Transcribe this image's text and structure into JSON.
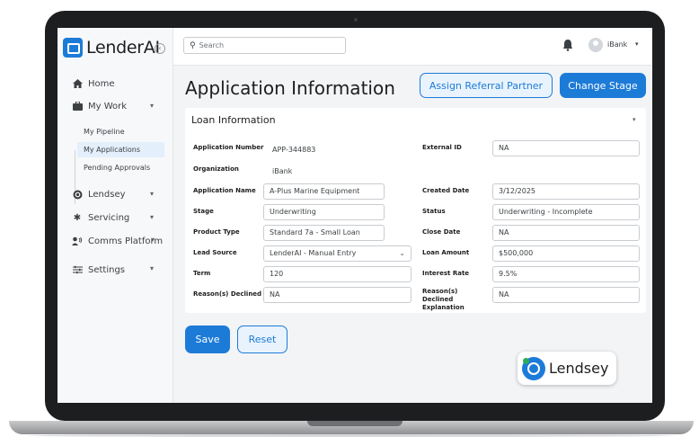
{
  "app": {
    "logo_text": "LenderAI"
  },
  "sidebar": {
    "items": [
      {
        "label": "Home"
      },
      {
        "label": "My Work"
      },
      {
        "label": "Lendsey"
      },
      {
        "label": "Servicing"
      },
      {
        "label": "Comms Platform"
      },
      {
        "label": "Settings"
      }
    ],
    "sub_items": [
      {
        "label": "My Pipeline",
        "active": false
      },
      {
        "label": "My Applications",
        "active": true
      },
      {
        "label": "Pending Approvals",
        "active": false
      }
    ]
  },
  "topbar": {
    "search_placeholder": "Search",
    "user_name": "iBank"
  },
  "main": {
    "title": "Application Information",
    "assign_button": "Assign Referral Partner",
    "change_stage_button": "Change Stage",
    "section_title": "Loan Information",
    "fields": {
      "application_number": {
        "label": "Application Number",
        "value": "APP-344883"
      },
      "organization": {
        "label": "Organization",
        "value": "iBank"
      },
      "application_name": {
        "label": "Application Name",
        "value": "A-Plus Marine Equipment"
      },
      "stage": {
        "label": "Stage",
        "value": "Underwriting"
      },
      "product_type": {
        "label": "Product Type",
        "value": "Standard 7a - Small Loan"
      },
      "lead_source": {
        "label": "Lead Source",
        "value": "LenderAI - Manual Entry"
      },
      "term": {
        "label": "Term",
        "value": "120"
      },
      "reasons_declined": {
        "label": "Reason(s) Declined",
        "value": "NA"
      },
      "external_id": {
        "label": "External ID",
        "value": "NA"
      },
      "created_date": {
        "label": "Created Date",
        "value": "3/12/2025"
      },
      "status": {
        "label": "Status",
        "value": "Underwriting - Incomplete"
      },
      "close_date": {
        "label": "Close Date",
        "value": "NA"
      },
      "loan_amount": {
        "label": "Loan Amount",
        "value": "$500,000"
      },
      "interest_rate": {
        "label": "Interest Rate",
        "value": "9.5%"
      },
      "reasons_declined_explanation": {
        "label": "Reason(s) Declined Explanation",
        "value": "NA"
      }
    },
    "save_button": "Save",
    "reset_button": "Reset",
    "badge_text": "Lendsey"
  },
  "colors": {
    "accent": "#1d7bd8",
    "accent_light": "#e9f3fd",
    "active_nav": "#e3effb"
  },
  "icons": [
    "home-icon",
    "briefcase-icon",
    "lendsey-icon",
    "gear-icon",
    "comms-icon",
    "settings-sliders-icon",
    "search-icon",
    "bell-icon",
    "avatar-icon",
    "chevron-down-icon",
    "chevron-left-icon"
  ]
}
